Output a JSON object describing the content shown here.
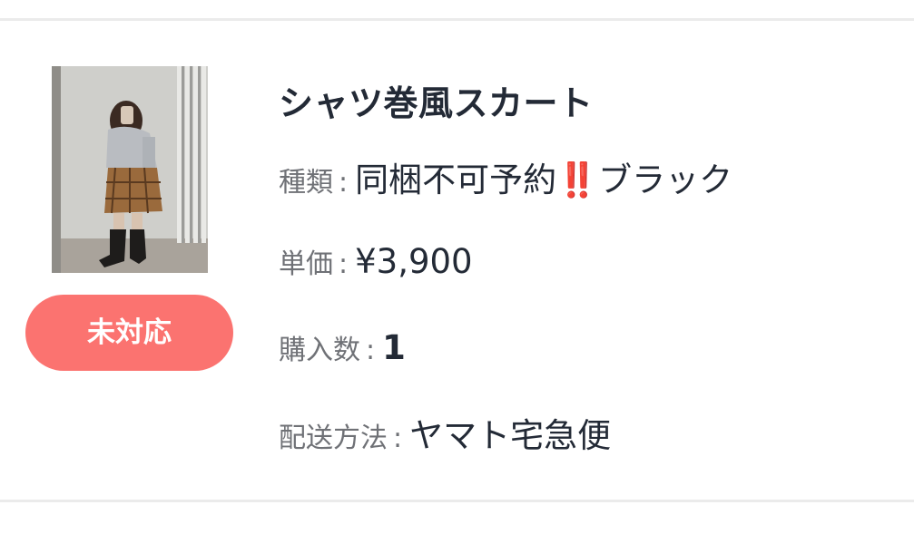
{
  "order": {
    "product_name": "シャツ巻風スカート",
    "status_label": "未対応",
    "variant": {
      "label": "種類",
      "separator": ":",
      "value": "同梱不可予約‼️ブラック"
    },
    "unit_price": {
      "label": "単価",
      "separator": ":",
      "value": "¥3,900"
    },
    "quantity": {
      "label": "購入数",
      "separator": ":",
      "value": "1"
    },
    "shipping": {
      "label": "配送方法",
      "separator": ":",
      "value": "ヤマト宅急便"
    }
  },
  "colors": {
    "status_badge": "#fb7370",
    "text_primary": "#232a36",
    "text_label": "#6f7176",
    "divider": "#ebebeb"
  }
}
